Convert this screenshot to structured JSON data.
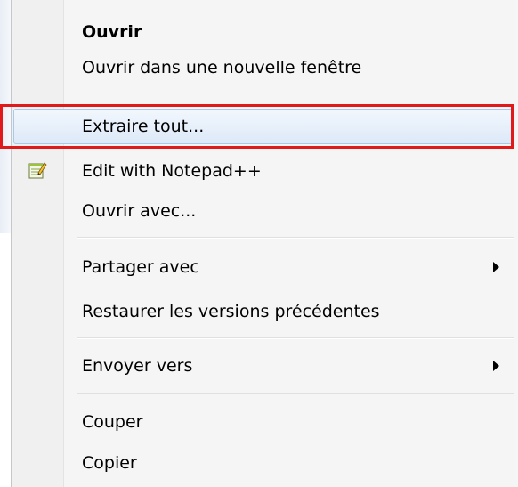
{
  "context_menu": {
    "items": [
      {
        "label": "Ouvrir",
        "bold": true
      },
      {
        "label": "Ouvrir dans une nouvelle fenêtre"
      },
      {
        "label": "Extraire tout..."
      },
      {
        "label": "Edit with Notepad++",
        "icon": "notepad-plus-plus-icon"
      },
      {
        "label": "Ouvrir avec..."
      },
      {
        "label": "Partager avec",
        "submenu": true
      },
      {
        "label": "Restaurer les versions précédentes"
      },
      {
        "label": "Envoyer vers",
        "submenu": true
      },
      {
        "label": "Couper"
      },
      {
        "label": "Copier"
      }
    ],
    "highlighted_item": "Extraire tout...",
    "highlight_outline_color": "#e01a1a",
    "hover_color": "#dde9f8"
  }
}
